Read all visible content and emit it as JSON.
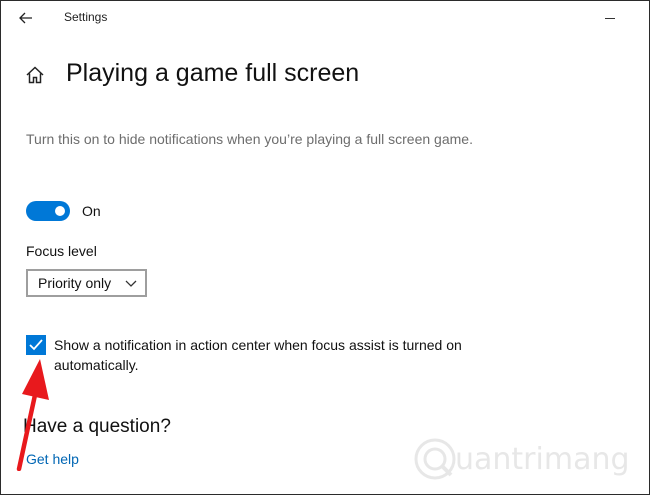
{
  "window": {
    "title": "Settings"
  },
  "page": {
    "title": "Playing a game full screen",
    "description": "Turn this on to hide notifications when you’re playing a full screen game."
  },
  "toggle": {
    "state_label": "On",
    "is_on": true
  },
  "focus_level": {
    "label": "Focus level",
    "selected": "Priority only"
  },
  "checkbox": {
    "label": "Show a notification in action center when focus assist is turned on automatically.",
    "checked": true
  },
  "help": {
    "heading": "Have a question?",
    "link": "Get help"
  },
  "watermark": {
    "text": "uantrimang"
  },
  "colors": {
    "accent": "#0078d7",
    "link": "#0066b4",
    "annotation_arrow": "#e8191d"
  },
  "icons": [
    "back-arrow-icon",
    "minimize-icon",
    "home-icon",
    "chevron-down-icon",
    "checkmark-icon"
  ]
}
